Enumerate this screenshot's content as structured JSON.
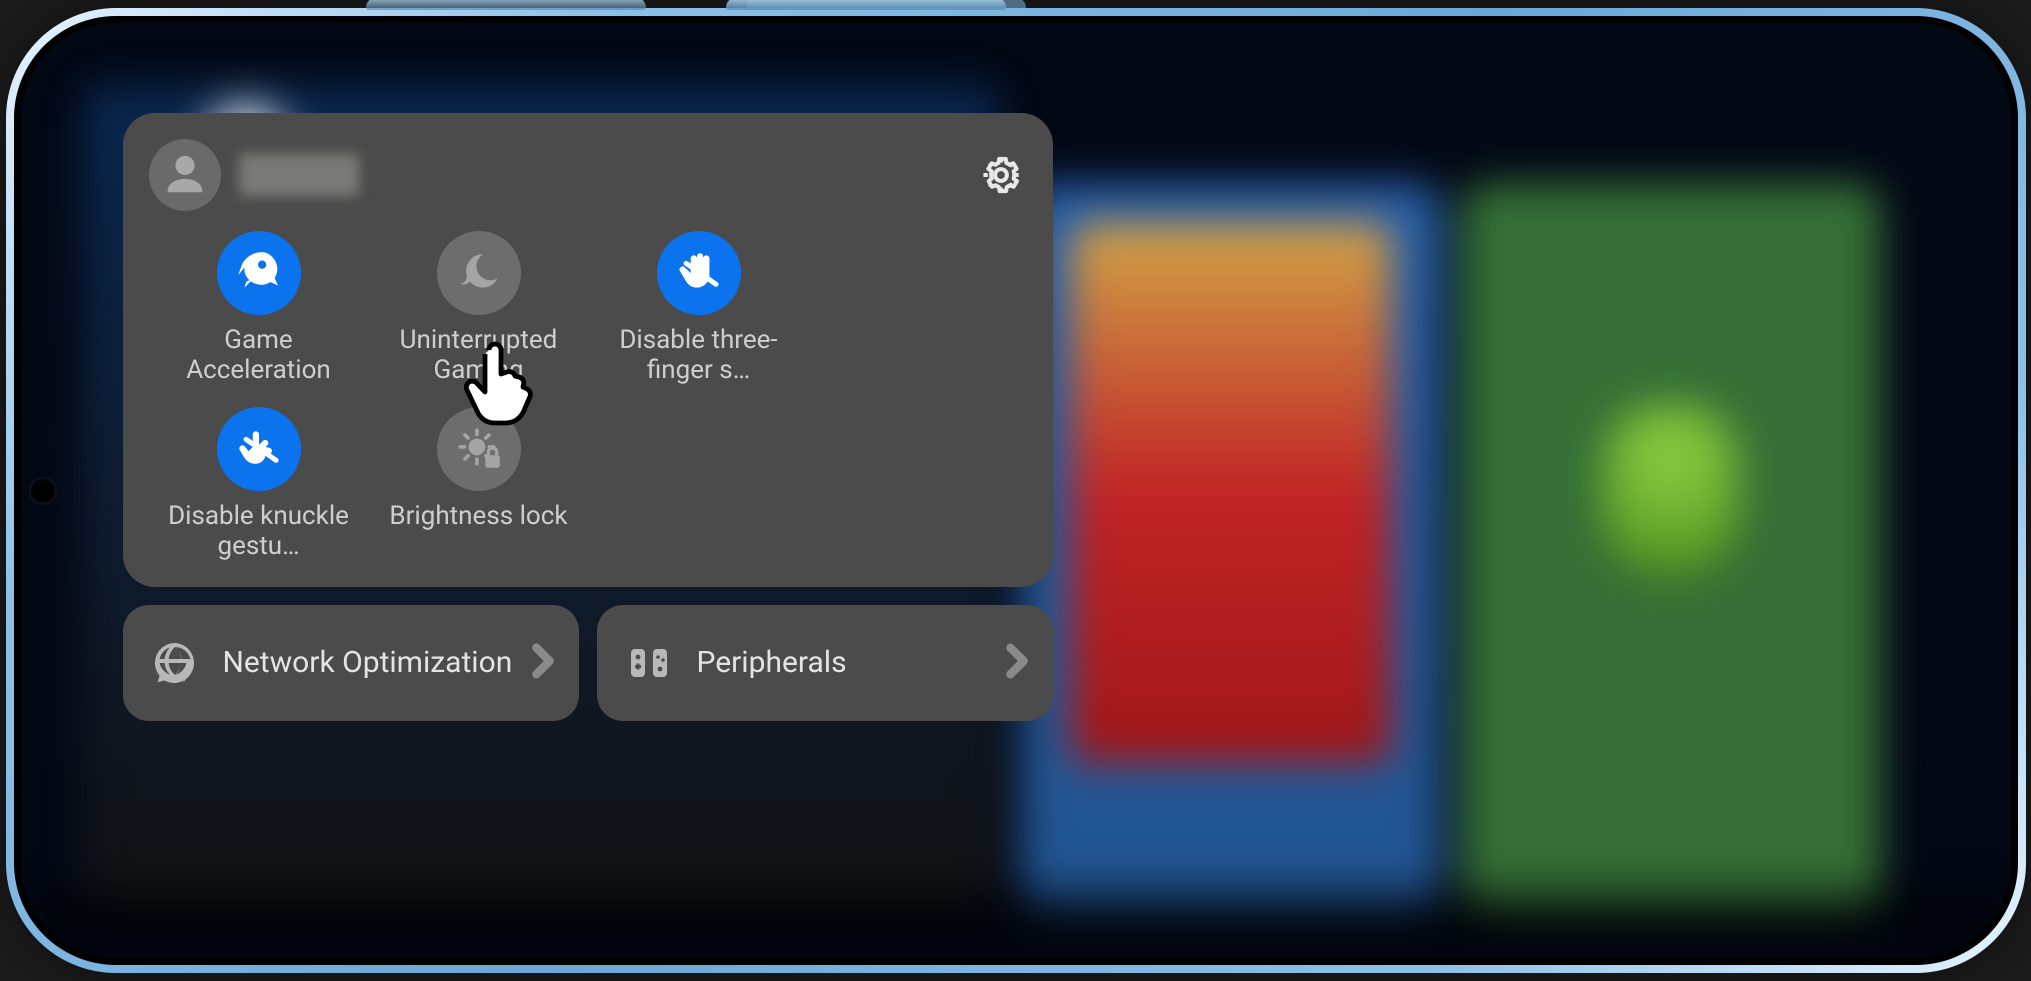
{
  "header": {
    "username": "(redacted)"
  },
  "toggles": [
    {
      "id": "game-acceleration",
      "label": "Game Acceleration",
      "active": true
    },
    {
      "id": "uninterrupted-gaming",
      "label": "Uninterrupted Gaming",
      "active": false
    },
    {
      "id": "disable-three-finger",
      "label": "Disable three-finger s…",
      "active": true
    },
    {
      "id": "disable-knuckle",
      "label": "Disable knuckle gestu…",
      "active": true
    },
    {
      "id": "brightness-lock",
      "label": "Brightness lock",
      "active": false
    }
  ],
  "rows": [
    {
      "id": "network-optimization",
      "label": "Network Optimization"
    },
    {
      "id": "peripherals",
      "label": "Peripherals"
    }
  ],
  "colors": {
    "panel_bg": "#4b4b4b",
    "toggle_on": "#0b73ee",
    "toggle_off": "#6d6d6d"
  }
}
